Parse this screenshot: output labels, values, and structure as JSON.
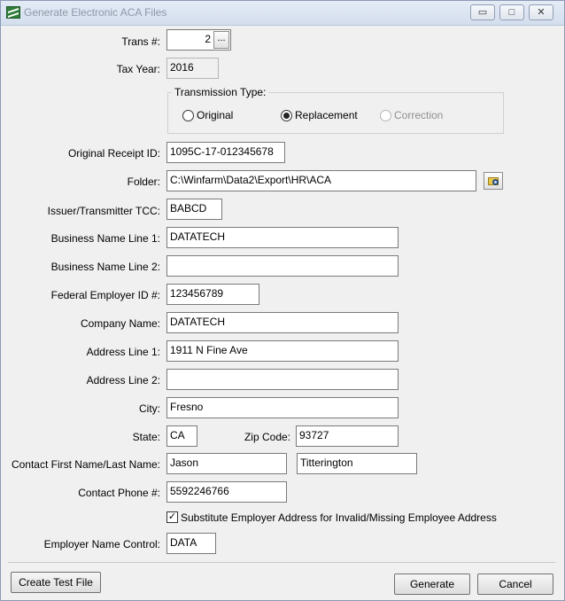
{
  "window": {
    "title": "Generate Electronic ACA Files",
    "controls": {
      "minimize": "▭",
      "maximize": "□",
      "close": "✕"
    }
  },
  "form": {
    "trans_no": {
      "label": "Trans #:",
      "value": "2",
      "browse": "..."
    },
    "tax_year": {
      "label": "Tax Year:",
      "value": "2016"
    },
    "transmission": {
      "title": "Transmission Type:",
      "options": [
        {
          "label": "Original",
          "checked": false,
          "disabled": false
        },
        {
          "label": "Replacement",
          "checked": true,
          "disabled": false
        },
        {
          "label": "Correction",
          "checked": false,
          "disabled": true
        }
      ]
    },
    "original_receipt": {
      "label": "Original Receipt ID:",
      "value": "1095C-17-012345678"
    },
    "folder": {
      "label": "Folder:",
      "value": "C:\\Winfarm\\Data2\\Export\\HR\\ACA"
    },
    "tcc": {
      "label": "Issuer/Transmitter TCC:",
      "value": "BABCD"
    },
    "business_name_1": {
      "label": "Business Name Line 1:",
      "value": "DATATECH"
    },
    "business_name_2": {
      "label": "Business Name Line 2:",
      "value": ""
    },
    "fein": {
      "label": "Federal Employer ID #:",
      "value": "123456789"
    },
    "company_name": {
      "label": "Company Name:",
      "value": "DATATECH"
    },
    "address_1": {
      "label": "Address Line 1:",
      "value": "1911 N Fine Ave"
    },
    "address_2": {
      "label": "Address Line 2:",
      "value": ""
    },
    "city": {
      "label": "City:",
      "value": "Fresno"
    },
    "state": {
      "label": "State:",
      "value": "CA"
    },
    "zip": {
      "label": "Zip Code:",
      "value": "93727"
    },
    "contact_name": {
      "label": "Contact First Name/Last Name:",
      "first": "Jason",
      "last": "Titterington"
    },
    "contact_phone": {
      "label": "Contact Phone #:",
      "value": "5592246766"
    },
    "substitute": {
      "label": "Substitute Employer Address for Invalid/Missing Employee Address",
      "checked": "✓"
    },
    "name_control": {
      "label": "Employer Name Control:",
      "value": "DATA"
    }
  },
  "buttons": {
    "create_test": "Create Test File",
    "generate": "Generate",
    "cancel": "Cancel"
  },
  "icons": {
    "app": "aca-app-icon",
    "folder_browse": "folder-search-icon"
  }
}
